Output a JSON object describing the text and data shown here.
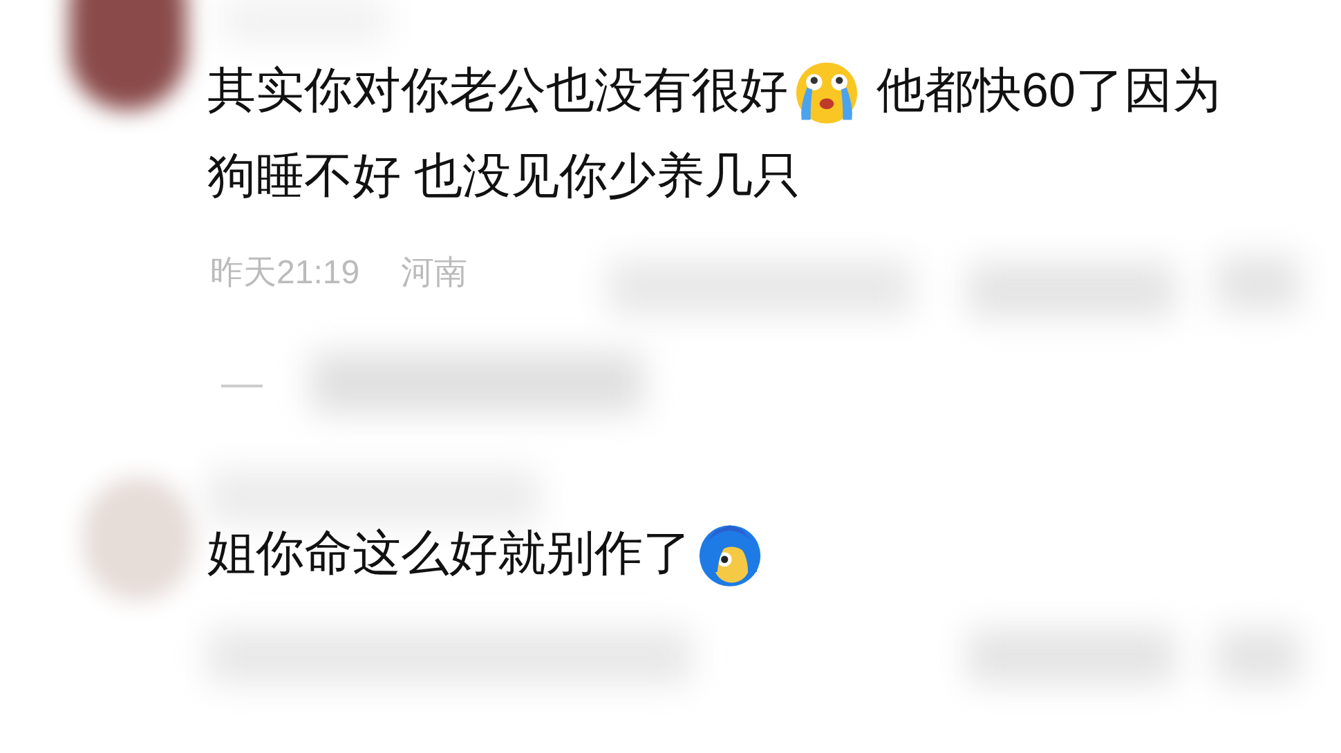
{
  "comments": [
    {
      "line_1_before": "其实你对你老公也没有很好",
      "emoji": {
        "kind": "crying"
      },
      "line_1_after": "他都快60了因为",
      "line_2": "狗睡不好 也没见你少养几只",
      "meta": [
        "昨天21:19",
        "河南"
      ],
      "reply_mark": "—"
    },
    {
      "line_1_before": "姐你命这么好就别作了",
      "emoji": {
        "kind": "blue-hair"
      }
    }
  ]
}
